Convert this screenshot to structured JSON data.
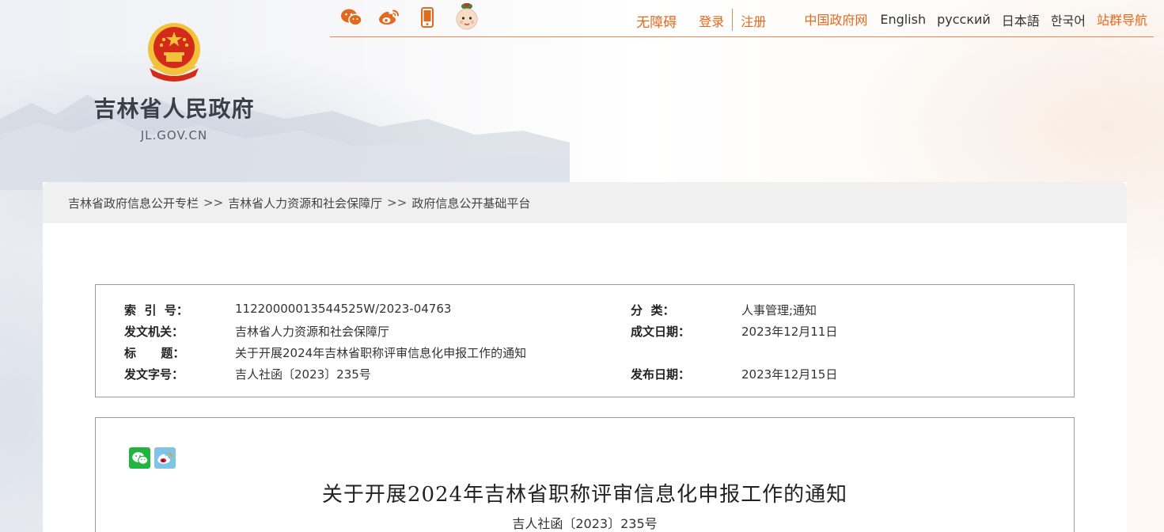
{
  "header": {
    "site_title": "吉林省人民政府",
    "site_domain": "JL.GOV.CN",
    "share_icons": [
      "wechat-icon",
      "weibo-icon",
      "mobile-icon",
      "mascot-icon"
    ],
    "nav": {
      "accessible": "无障碍",
      "login": "登录",
      "register": "注册",
      "gov_portal": "中国政府网",
      "languages": [
        "English",
        "русский",
        "日本語",
        "한국어"
      ],
      "site_group": "站群导航"
    },
    "colors": {
      "accent": "#e16a1e",
      "emblem_red": "#d42a1a",
      "emblem_gold": "#f2c23a"
    }
  },
  "breadcrumb": {
    "items": [
      "吉林省政府信息公开专栏",
      "吉林省人力资源和社会保障厅",
      "政府信息公开基础平台"
    ],
    "separator": ">>"
  },
  "meta": {
    "index_no_label": "索  引  号：",
    "index_no": "11220000013544525W/2023-04763",
    "category_label": "分  类：",
    "category": "人事管理;通知",
    "issuer_label": "发文机关：",
    "issuer": "吉林省人力资源和社会保障厅",
    "created_date_label": "成文日期：",
    "created_date": "2023年12月11日",
    "title_label": "标      题：",
    "title": "关于开展2024年吉林省职称评审信息化申报工作的通知",
    "doc_no_label": "发文字号：",
    "doc_no": "吉人社函〔2023〕235号",
    "publish_date_label": "发布日期：",
    "publish_date": "2023年12月15日"
  },
  "article": {
    "share_icons": [
      "wechat-icon",
      "weibo-icon"
    ],
    "title": "关于开展2024年吉林省职称评审信息化申报工作的通知",
    "doc_no": "吉人社函〔2023〕235号"
  }
}
